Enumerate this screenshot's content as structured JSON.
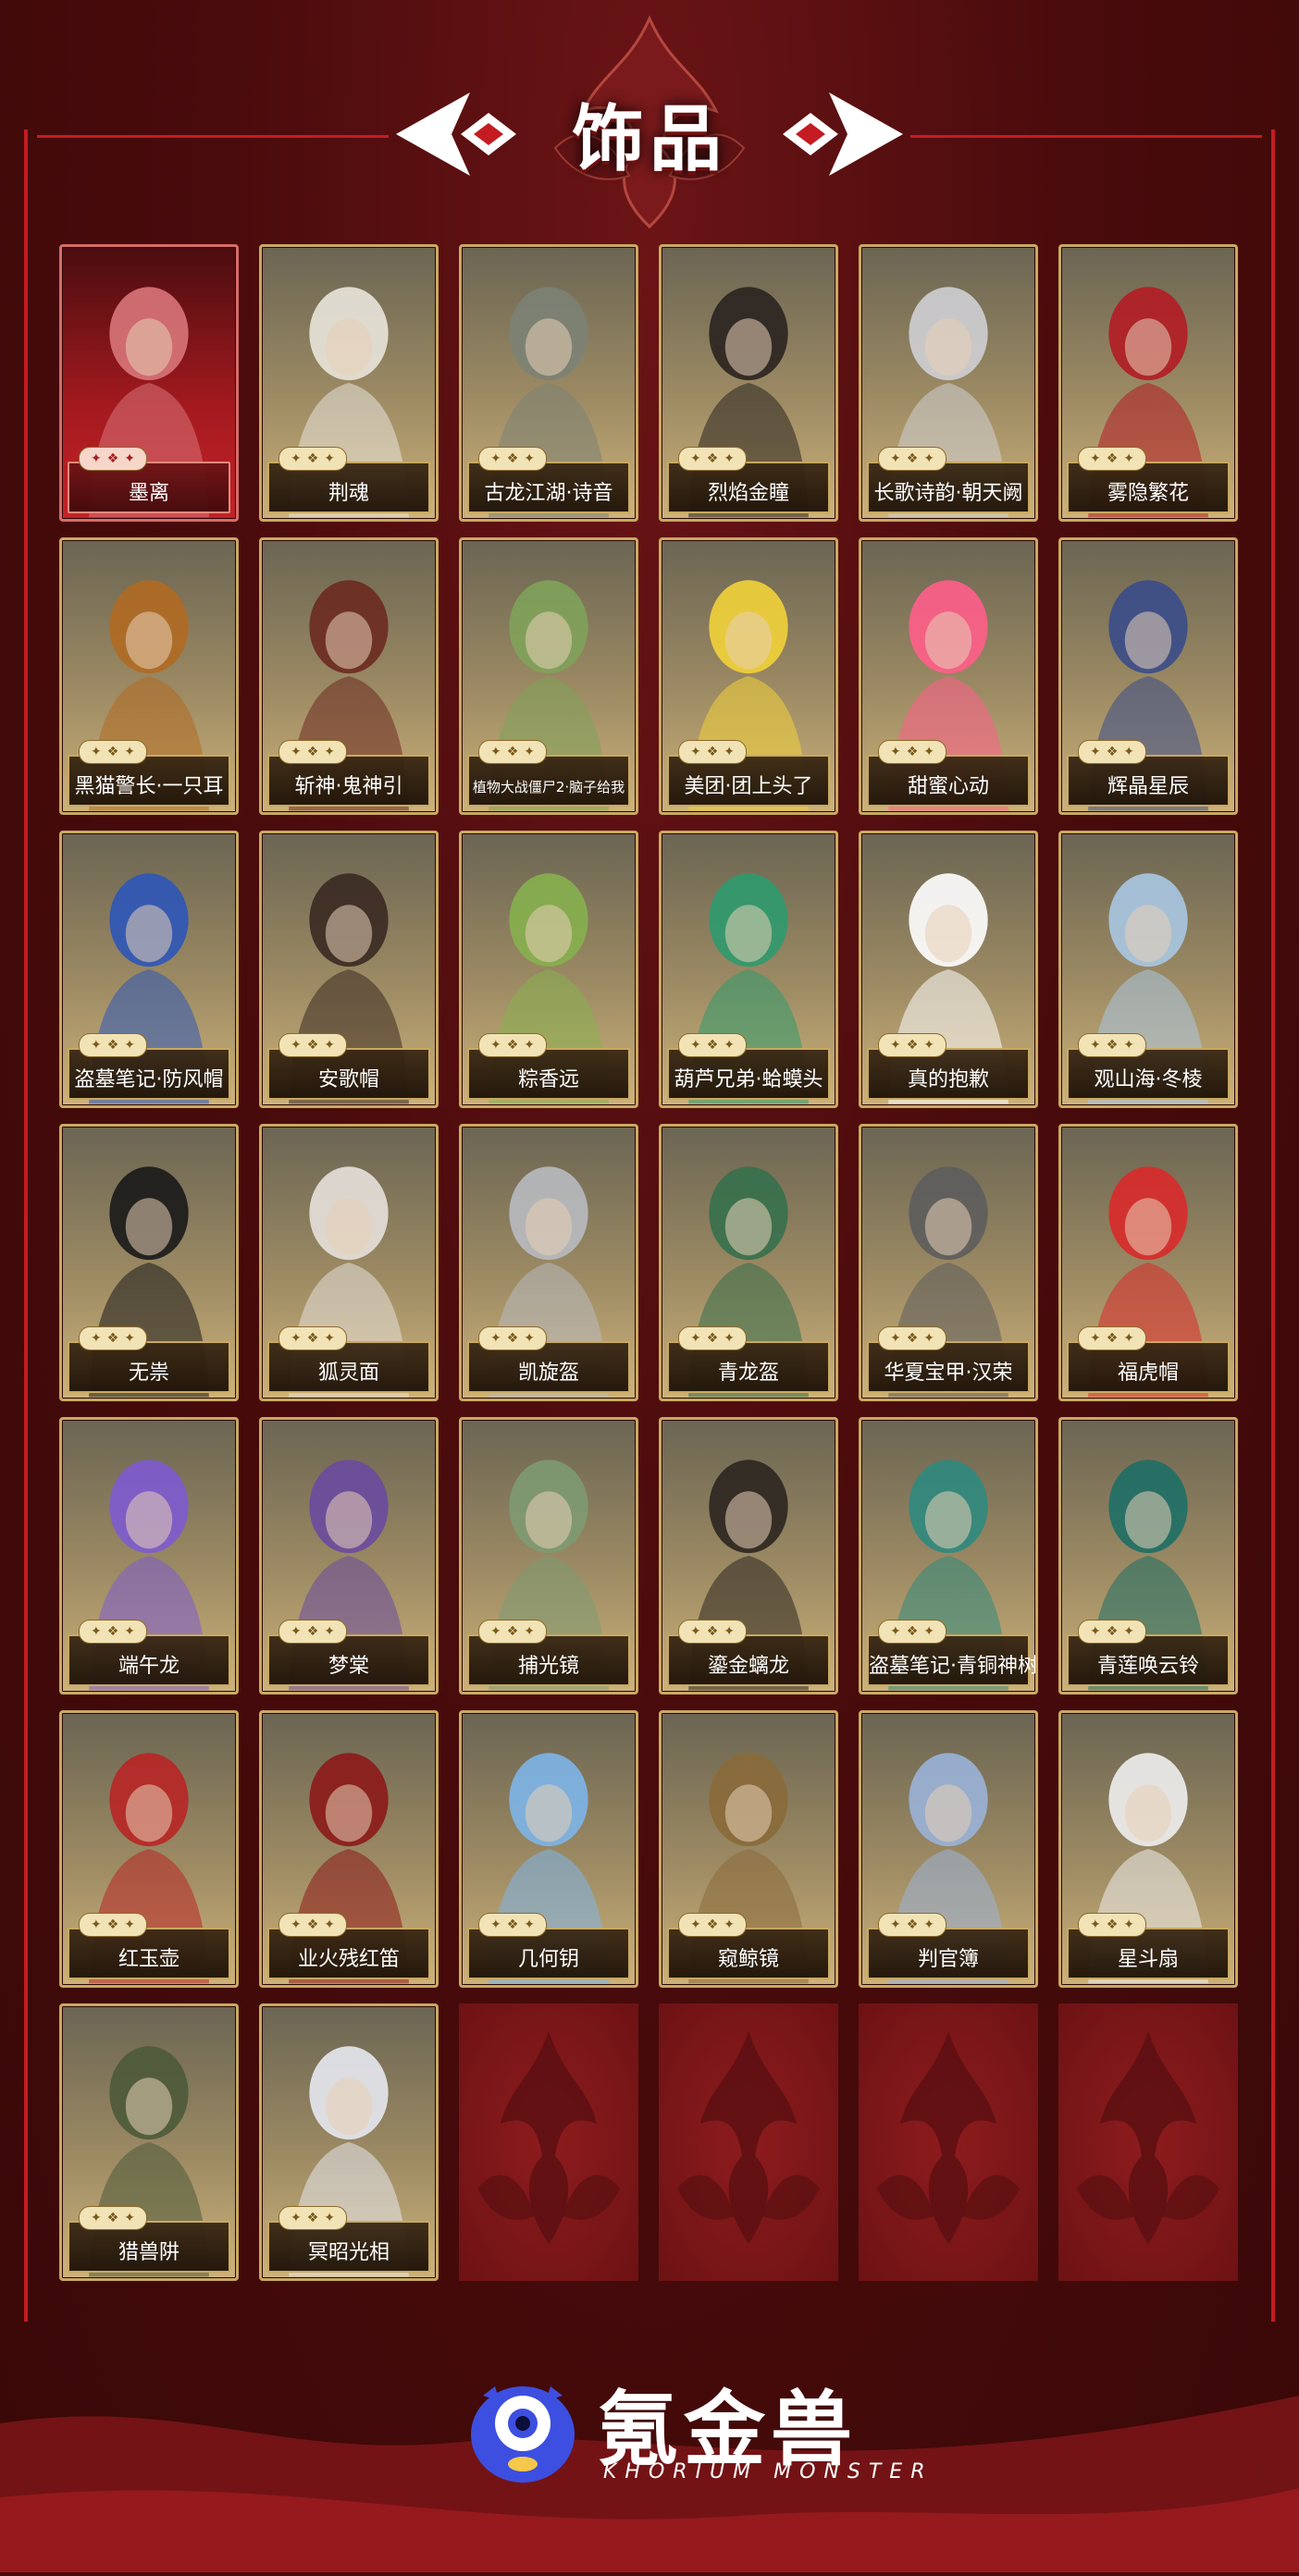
{
  "header": {
    "title": "饰品"
  },
  "items": [
    {
      "name": "墨离",
      "variant": "red",
      "art": "cursed-heart"
    },
    {
      "name": "荆魂",
      "art": "white-robe-belt"
    },
    {
      "name": "古龙江湖·诗音",
      "art": "grey-robe-tassel"
    },
    {
      "name": "烈焰金瞳",
      "art": "male-headband"
    },
    {
      "name": "长歌诗韵·朝天阙",
      "art": "silver-hair-crown"
    },
    {
      "name": "雾隐繁花",
      "art": "red-mask-woman"
    },
    {
      "name": "黑猫警长·一只耳",
      "art": "mouse-mask"
    },
    {
      "name": "斩神·鬼神引",
      "art": "red-robe-belt"
    },
    {
      "name": "植物大战僵尸2·脑子给我",
      "art": "zombie-head"
    },
    {
      "name": "美团·团上头了",
      "art": "rabbit-ears"
    },
    {
      "name": "甜蜜心动",
      "art": "heart-headpiece"
    },
    {
      "name": "辉晶星辰",
      "art": "witch-hat"
    },
    {
      "name": "盗墓笔记·防风帽",
      "art": "blue-hood"
    },
    {
      "name": "安歌帽",
      "art": "feather-hat"
    },
    {
      "name": "粽香远",
      "art": "zongzi-hat"
    },
    {
      "name": "葫芦兄弟·蛤蟆头",
      "art": "frog-head"
    },
    {
      "name": "真的抱歉",
      "art": "panda-head"
    },
    {
      "name": "观山海·冬棱",
      "art": "ice-antlers"
    },
    {
      "name": "无祟",
      "art": "black-veil"
    },
    {
      "name": "狐灵面",
      "art": "fox-mask"
    },
    {
      "name": "凯旋盔",
      "art": "silver-helmet"
    },
    {
      "name": "青龙盔",
      "art": "green-helmet"
    },
    {
      "name": "华夏宝甲·汉荣",
      "art": "plume-helmet"
    },
    {
      "name": "福虎帽",
      "art": "tiger-hat"
    },
    {
      "name": "端午龙",
      "art": "dragon-head"
    },
    {
      "name": "梦棠",
      "art": "flower-headband"
    },
    {
      "name": "捕光镜",
      "art": "green-dress-mirror"
    },
    {
      "name": "鎏金螭龙",
      "art": "dark-robe-dragon"
    },
    {
      "name": "盗墓笔记·青铜神树",
      "art": "bronze-tree"
    },
    {
      "name": "青莲唤云铃",
      "art": "teal-belt-bell"
    },
    {
      "name": "红玉壶",
      "art": "red-gourd"
    },
    {
      "name": "业火残红笛",
      "art": "red-flute"
    },
    {
      "name": "几何钥",
      "art": "crystal-key"
    },
    {
      "name": "窥鲸镜",
      "art": "bronze-gauntlet"
    },
    {
      "name": "判官簿",
      "art": "blue-robe-book"
    },
    {
      "name": "星斗扇",
      "art": "white-robe-fan"
    },
    {
      "name": "猎兽阱",
      "art": "trap-belt"
    },
    {
      "name": "冥昭光相",
      "art": "light-orb"
    }
  ],
  "empty_slots": 4,
  "footer": {
    "brand_cn": "氪金兽",
    "brand_en": "KHORIUM MONSTER"
  },
  "colors": {
    "accent_red": "#c41c22",
    "gold_frame": "#c9a961",
    "background": "#4a0b0c"
  }
}
